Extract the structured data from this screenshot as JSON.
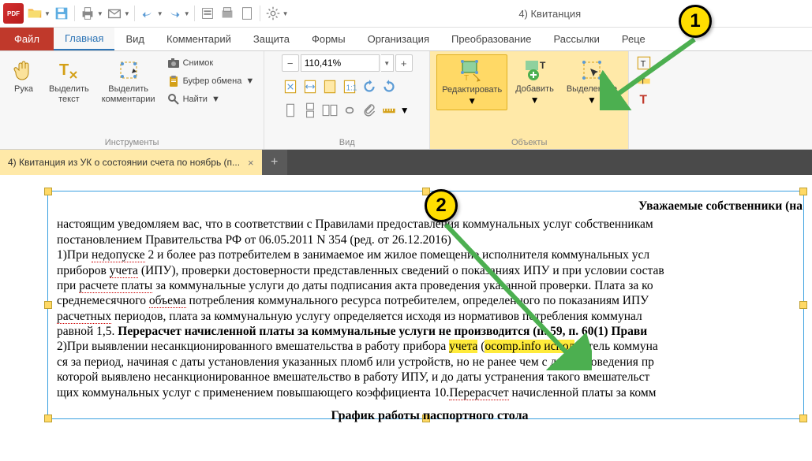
{
  "app": {
    "title": "4) Квитанция"
  },
  "tabs": {
    "file": "Файл",
    "items": [
      "Главная",
      "Вид",
      "Комментарий",
      "Защита",
      "Формы",
      "Организация",
      "Преобразование",
      "Рассылки",
      "Реце"
    ],
    "active": 0
  },
  "ribbon": {
    "tools": {
      "label": "Инструменты",
      "hand": "Рука",
      "select_text": "Выделить\nтекст",
      "select_comments": "Выделить\nкомментарии",
      "snapshot": "Снимок",
      "clipboard": "Буфер обмена",
      "find": "Найти"
    },
    "view": {
      "label": "Вид",
      "zoom": "110,41%"
    },
    "objects": {
      "label": "Объекты",
      "edit": "Редактировать",
      "add": "Добавить",
      "selected": "Выделенное"
    }
  },
  "doc_tab": {
    "label": "4) Квитанция из УК о состоянии счета по ноябрь (п..."
  },
  "document": {
    "heading": "Уважаемые собственники (на",
    "l1a": "настоящим уведомляем вас, что в соответствии с Правилами предоставления коммунальных услуг собственникам",
    "l1b": "постановлением Правительства РФ от 06.05.2011 N 354 (ред. от 26.12.2016)",
    "l2a": "1)При ",
    "l2u": "недопуске",
    "l2b": " 2 и более раз потребителем в занимаемое им жилое помещение исполнителя коммунальных усл",
    "l3a": "приборов ",
    "l3u": "учета",
    "l3b": " (ИПУ), проверки достоверности представленных сведений о показаниях ИПУ и при условии состав",
    "l4a": "при ",
    "l4u": "расчете платы",
    "l4b": " за коммунальные услуги до даты подписания акта проведения указанной проверки. Плата за ко",
    "l5a": "среднемесячного ",
    "l5u": "объема",
    "l5b": " потребления коммунального ресурса потребителем, определенного по показаниям ИПУ ",
    "l6a": "",
    "l6u": "расчетных",
    "l6b": " периодов, плата за коммунальную услугу определяется исходя из нормативов потребления коммунал",
    "l7a": "равной 1,5. ",
    "l7bold": "Перерасчет начисленной платы за коммунальные услуги не производится (п. 59, п. 60(1) Прави",
    "l8a": "2)При выявлении несанкционированного вмешательства в работу прибора ",
    "l8h1": "учета",
    "l8p1": " (",
    "l8h2": "ocomp.info",
    "l8p2": " испол",
    "l8b": "нитель коммуна",
    "l9": "ся за период, начиная с даты установления указанных пломб или устройств, но не ранее чем с даты проведения пр",
    "l10": "которой выявлено несанкционированное вмешательство в работу ИПУ, и до даты устранения такого вмешательст",
    "l11a": "щих коммунальных услуг с применением повышающего коэффициента 10.",
    "l11u": "Перерасчет",
    "l11b": " начисленной платы за комм",
    "subheading": "График работы паспортного стола"
  },
  "callouts": {
    "c1": "1",
    "c2": "2"
  }
}
